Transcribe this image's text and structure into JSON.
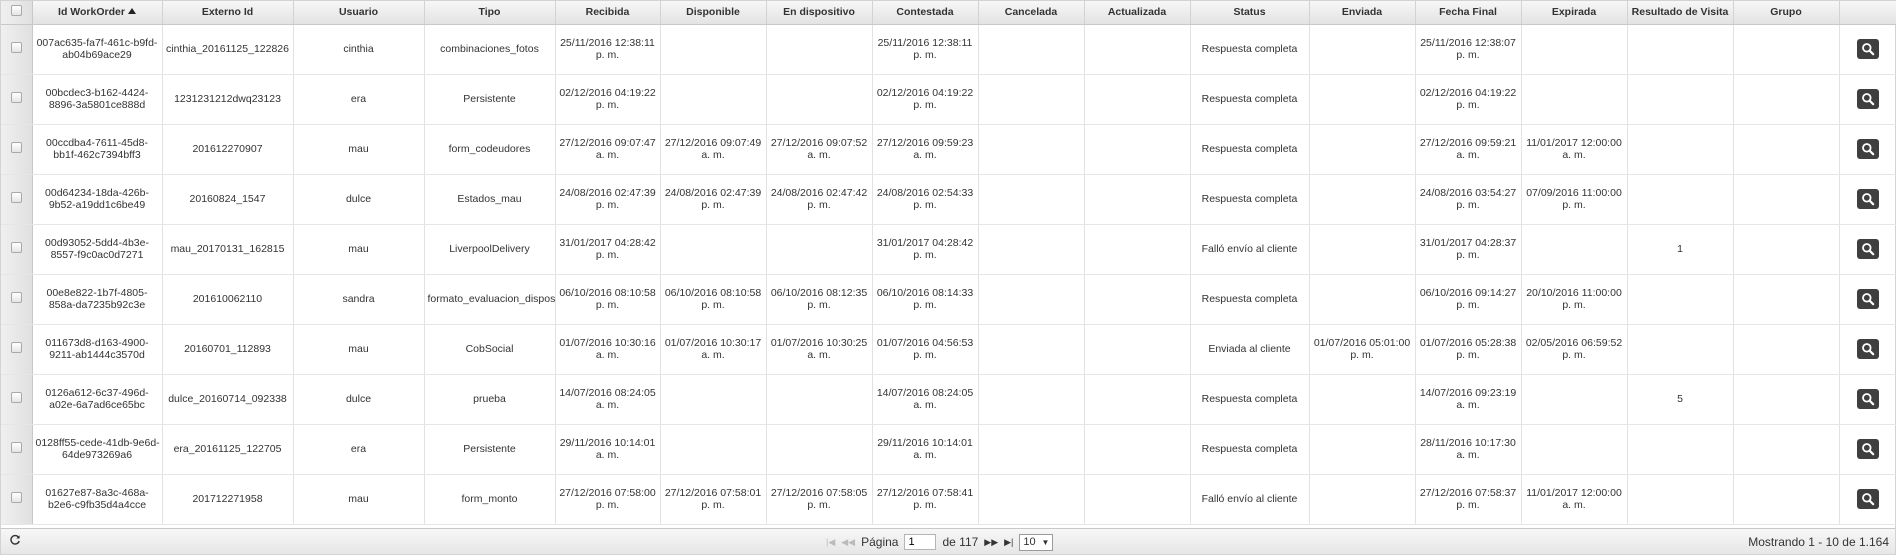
{
  "grid": {
    "columns": [
      {
        "key": "select",
        "label": ""
      },
      {
        "key": "id",
        "label": "Id WorkOrder"
      },
      {
        "key": "externo",
        "label": "Externo Id"
      },
      {
        "key": "usuario",
        "label": "Usuario"
      },
      {
        "key": "tipo",
        "label": "Tipo"
      },
      {
        "key": "recibida",
        "label": "Recibida"
      },
      {
        "key": "disponible",
        "label": "Disponible"
      },
      {
        "key": "en_dispositivo",
        "label": "En dispositivo"
      },
      {
        "key": "contestada",
        "label": "Contestada"
      },
      {
        "key": "cancelada",
        "label": "Cancelada"
      },
      {
        "key": "actualizada",
        "label": "Actualizada"
      },
      {
        "key": "status",
        "label": "Status"
      },
      {
        "key": "enviada",
        "label": "Enviada"
      },
      {
        "key": "fecha_final",
        "label": "Fecha Final"
      },
      {
        "key": "expirada",
        "label": "Expirada"
      },
      {
        "key": "resultado",
        "label": "Resultado de Visita"
      },
      {
        "key": "grupo",
        "label": "Grupo"
      },
      {
        "key": "action",
        "label": ""
      }
    ],
    "sort": {
      "column": "id",
      "direction": "asc",
      "icon": "sort-asc-icon"
    },
    "rows": [
      {
        "id_l1": "007ac635-fa7f-461c-b9fd-",
        "id_l2": "ab04b69ace29",
        "externo": "cinthia_20161125_122826",
        "usuario": "cinthia",
        "tipo": "combinaciones_fotos",
        "recibida_l1": "25/11/2016 12:38:11",
        "recibida_l2": "p. m.",
        "disponible_l1": "",
        "disponible_l2": "",
        "en_dispositivo_l1": "",
        "en_dispositivo_l2": "",
        "contestada_l1": "25/11/2016 12:38:11",
        "contestada_l2": "p. m.",
        "cancelada": "",
        "actualizada": "",
        "status": "Respuesta completa",
        "enviada_l1": "",
        "enviada_l2": "",
        "fecha_final_l1": "25/11/2016 12:38:07",
        "fecha_final_l2": "p. m.",
        "expirada_l1": "",
        "expirada_l2": "",
        "resultado": "",
        "grupo": ""
      },
      {
        "id_l1": "00bcdec3-b162-4424-",
        "id_l2": "8896-3a5801ce888d",
        "externo": "1231231212dwq23123",
        "usuario": "era",
        "tipo": "Persistente",
        "recibida_l1": "02/12/2016 04:19:22",
        "recibida_l2": "p. m.",
        "disponible_l1": "",
        "disponible_l2": "",
        "en_dispositivo_l1": "",
        "en_dispositivo_l2": "",
        "contestada_l1": "02/12/2016 04:19:22",
        "contestada_l2": "p. m.",
        "cancelada": "",
        "actualizada": "",
        "status": "Respuesta completa",
        "enviada_l1": "",
        "enviada_l2": "",
        "fecha_final_l1": "02/12/2016 04:19:22",
        "fecha_final_l2": "p. m.",
        "expirada_l1": "",
        "expirada_l2": "",
        "resultado": "",
        "grupo": ""
      },
      {
        "id_l1": "00ccdba4-7611-45d8-",
        "id_l2": "bb1f-462c7394bff3",
        "externo": "201612270907",
        "usuario": "mau",
        "tipo": "form_codeudores",
        "recibida_l1": "27/12/2016 09:07:47",
        "recibida_l2": "a. m.",
        "disponible_l1": "27/12/2016 09:07:49",
        "disponible_l2": "a. m.",
        "en_dispositivo_l1": "27/12/2016 09:07:52",
        "en_dispositivo_l2": "a. m.",
        "contestada_l1": "27/12/2016 09:59:23",
        "contestada_l2": "a. m.",
        "cancelada": "",
        "actualizada": "",
        "status": "Respuesta completa",
        "enviada_l1": "",
        "enviada_l2": "",
        "fecha_final_l1": "27/12/2016 09:59:21",
        "fecha_final_l2": "a. m.",
        "expirada_l1": "11/01/2017 12:00:00",
        "expirada_l2": "a. m.",
        "resultado": "",
        "grupo": ""
      },
      {
        "id_l1": "00d64234-18da-426b-",
        "id_l2": "9b52-a19dd1c6be49",
        "externo": "20160824_1547",
        "usuario": "dulce",
        "tipo": "Estados_mau",
        "recibida_l1": "24/08/2016 02:47:39",
        "recibida_l2": "p. m.",
        "disponible_l1": "24/08/2016 02:47:39",
        "disponible_l2": "p. m.",
        "en_dispositivo_l1": "24/08/2016 02:47:42",
        "en_dispositivo_l2": "p. m.",
        "contestada_l1": "24/08/2016 02:54:33",
        "contestada_l2": "p. m.",
        "cancelada": "",
        "actualizada": "",
        "status": "Respuesta completa",
        "enviada_l1": "",
        "enviada_l2": "",
        "fecha_final_l1": "24/08/2016 03:54:27",
        "fecha_final_l2": "p. m.",
        "expirada_l1": "07/09/2016 11:00:00",
        "expirada_l2": "p. m.",
        "resultado": "",
        "grupo": ""
      },
      {
        "id_l1": "00d93052-5dd4-4b3e-",
        "id_l2": "8557-f9c0ac0d7271",
        "externo": "mau_20170131_162815",
        "usuario": "mau",
        "tipo": "LiverpoolDelivery",
        "recibida_l1": "31/01/2017 04:28:42",
        "recibida_l2": "p. m.",
        "disponible_l1": "",
        "disponible_l2": "",
        "en_dispositivo_l1": "",
        "en_dispositivo_l2": "",
        "contestada_l1": "31/01/2017 04:28:42",
        "contestada_l2": "p. m.",
        "cancelada": "",
        "actualizada": "",
        "status": "Falló envío al cliente",
        "enviada_l1": "",
        "enviada_l2": "",
        "fecha_final_l1": "31/01/2017 04:28:37",
        "fecha_final_l2": "p. m.",
        "expirada_l1": "",
        "expirada_l2": "",
        "resultado": "1",
        "grupo": ""
      },
      {
        "id_l1": "00e8e822-1b7f-4805-",
        "id_l2": "858a-da7235b92c3e",
        "externo": "201610062110",
        "usuario": "sandra",
        "tipo": "formato_evaluacion_disposi",
        "recibida_l1": "06/10/2016 08:10:58",
        "recibida_l2": "p. m.",
        "disponible_l1": "06/10/2016 08:10:58",
        "disponible_l2": "p. m.",
        "en_dispositivo_l1": "06/10/2016 08:12:35",
        "en_dispositivo_l2": "p. m.",
        "contestada_l1": "06/10/2016 08:14:33",
        "contestada_l2": "p. m.",
        "cancelada": "",
        "actualizada": "",
        "status": "Respuesta completa",
        "enviada_l1": "",
        "enviada_l2": "",
        "fecha_final_l1": "06/10/2016 09:14:27",
        "fecha_final_l2": "p. m.",
        "expirada_l1": "20/10/2016 11:00:00",
        "expirada_l2": "p. m.",
        "resultado": "",
        "grupo": ""
      },
      {
        "id_l1": "011673d8-d163-4900-",
        "id_l2": "9211-ab1444c3570d",
        "externo": "20160701_112893",
        "usuario": "mau",
        "tipo": "CobSocial",
        "recibida_l1": "01/07/2016 10:30:16",
        "recibida_l2": "a. m.",
        "disponible_l1": "01/07/2016 10:30:17",
        "disponible_l2": "a. m.",
        "en_dispositivo_l1": "01/07/2016 10:30:25",
        "en_dispositivo_l2": "a. m.",
        "contestada_l1": "01/07/2016 04:56:53",
        "contestada_l2": "p. m.",
        "cancelada": "",
        "actualizada": "",
        "status": "Enviada al cliente",
        "enviada_l1": "01/07/2016 05:01:00",
        "enviada_l2": "p. m.",
        "fecha_final_l1": "01/07/2016 05:28:38",
        "fecha_final_l2": "p. m.",
        "expirada_l1": "02/05/2016 06:59:52",
        "expirada_l2": "p. m.",
        "resultado": "",
        "grupo": ""
      },
      {
        "id_l1": "0126a612-6c37-496d-",
        "id_l2": "a02e-6a7ad6ce65bc",
        "externo": "dulce_20160714_092338",
        "usuario": "dulce",
        "tipo": "prueba",
        "recibida_l1": "14/07/2016 08:24:05",
        "recibida_l2": "a. m.",
        "disponible_l1": "",
        "disponible_l2": "",
        "en_dispositivo_l1": "",
        "en_dispositivo_l2": "",
        "contestada_l1": "14/07/2016 08:24:05",
        "contestada_l2": "a. m.",
        "cancelada": "",
        "actualizada": "",
        "status": "Respuesta completa",
        "enviada_l1": "",
        "enviada_l2": "",
        "fecha_final_l1": "14/07/2016 09:23:19",
        "fecha_final_l2": "a. m.",
        "expirada_l1": "",
        "expirada_l2": "",
        "resultado": "5",
        "grupo": ""
      },
      {
        "id_l1": "0128ff55-cede-41db-9e6d-",
        "id_l2": "64de973269a6",
        "externo": "era_20161125_122705",
        "usuario": "era",
        "tipo": "Persistente",
        "recibida_l1": "29/11/2016 10:14:01",
        "recibida_l2": "a. m.",
        "disponible_l1": "",
        "disponible_l2": "",
        "en_dispositivo_l1": "",
        "en_dispositivo_l2": "",
        "contestada_l1": "29/11/2016 10:14:01",
        "contestada_l2": "a. m.",
        "cancelada": "",
        "actualizada": "",
        "status": "Respuesta completa",
        "enviada_l1": "",
        "enviada_l2": "",
        "fecha_final_l1": "28/11/2016 10:17:30",
        "fecha_final_l2": "a. m.",
        "expirada_l1": "",
        "expirada_l2": "",
        "resultado": "",
        "grupo": ""
      },
      {
        "id_l1": "01627e87-8a3c-468a-",
        "id_l2": "b2e6-c9fb35d4a4cce",
        "externo": "201712271958",
        "usuario": "mau",
        "tipo": "form_monto",
        "recibida_l1": "27/12/2016 07:58:00",
        "recibida_l2": "p. m.",
        "disponible_l1": "27/12/2016 07:58:01",
        "disponible_l2": "p. m.",
        "en_dispositivo_l1": "27/12/2016 07:58:05",
        "en_dispositivo_l2": "p. m.",
        "contestada_l1": "27/12/2016 07:58:41",
        "contestada_l2": "p. m.",
        "cancelada": "",
        "actualizada": "",
        "status": "Falló envío al cliente",
        "enviada_l1": "",
        "enviada_l2": "",
        "fecha_final_l1": "27/12/2016 07:58:37",
        "fecha_final_l2": "p. m.",
        "expirada_l1": "11/01/2017 12:00:00",
        "expirada_l2": "a. m.",
        "resultado": "",
        "grupo": ""
      }
    ],
    "row_action_icon": "search-icon"
  },
  "pager": {
    "refresh_icon": "refresh-icon",
    "first_icon": "first-page-icon",
    "prev_icon": "prev-page-icon",
    "page_label": "Página",
    "page_value": "1",
    "of_label": "de 117",
    "next_icon": "next-page-icon",
    "last_icon": "last-page-icon",
    "rows_per_page": "10",
    "summary": "Mostrando 1 - 10 de 1.164"
  },
  "colors": {
    "header_bg": "#e8e8e8",
    "action_button": "#3f3f3f",
    "border": "#d3d3d3"
  }
}
